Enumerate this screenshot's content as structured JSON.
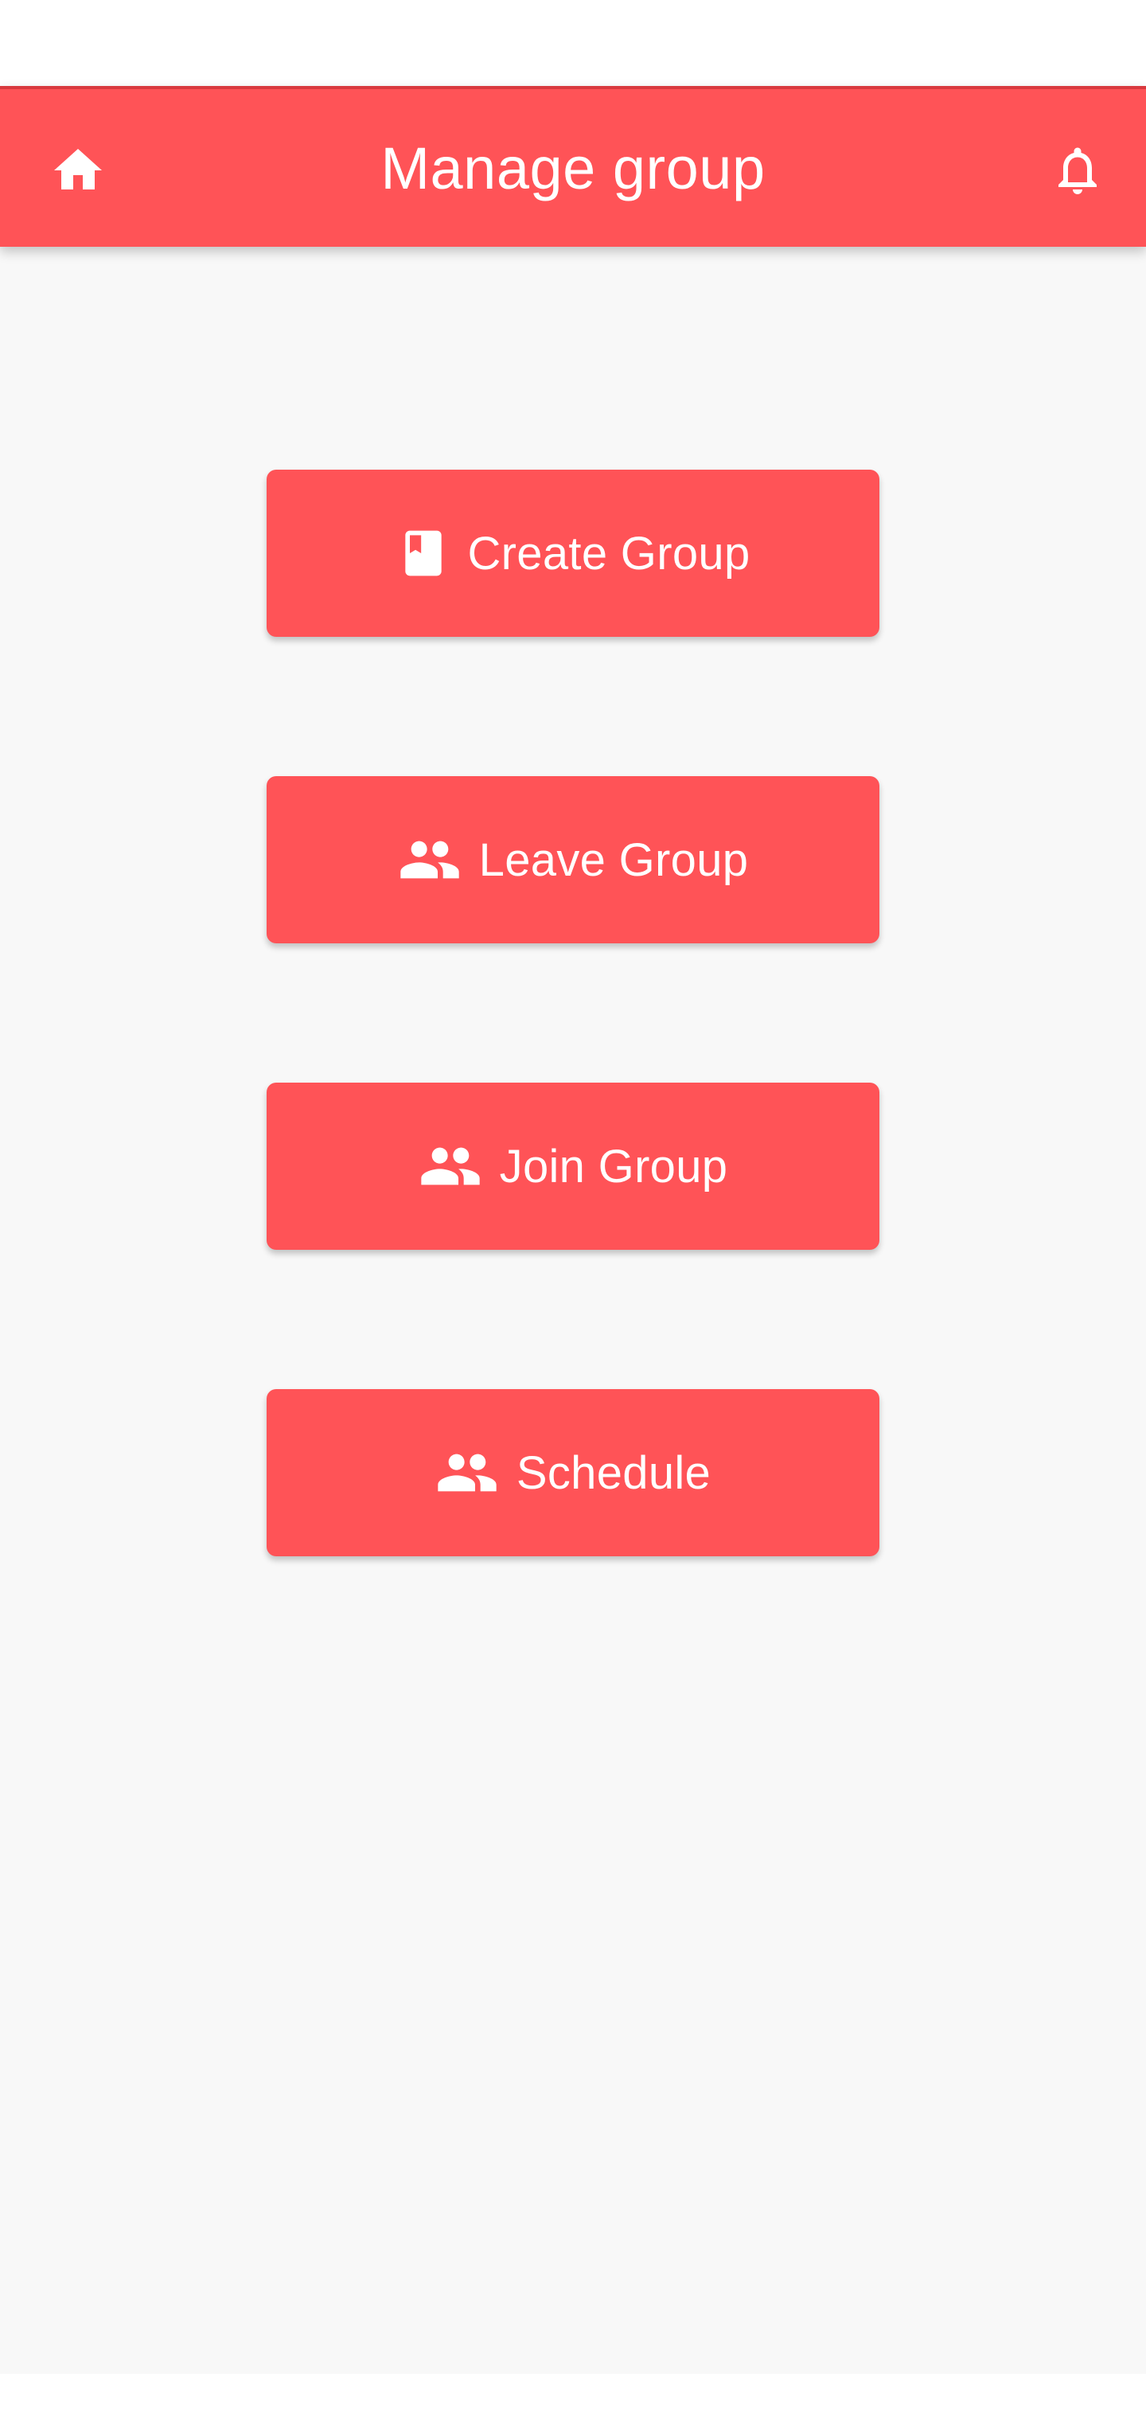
{
  "app_bar": {
    "title": "Manage group",
    "left_icon": "home-icon",
    "right_icon": "bell-icon",
    "background_color": "#ff5357"
  },
  "actions": [
    {
      "label": "Create Group",
      "icon": "book-icon"
    },
    {
      "label": "Leave Group",
      "icon": "people-icon"
    },
    {
      "label": "Join Group",
      "icon": "people-icon"
    },
    {
      "label": "Schedule",
      "icon": "people-icon"
    }
  ],
  "colors": {
    "accent": "#ff5357",
    "background": "#f8f8f8",
    "text_on_accent": "#ffffff"
  }
}
